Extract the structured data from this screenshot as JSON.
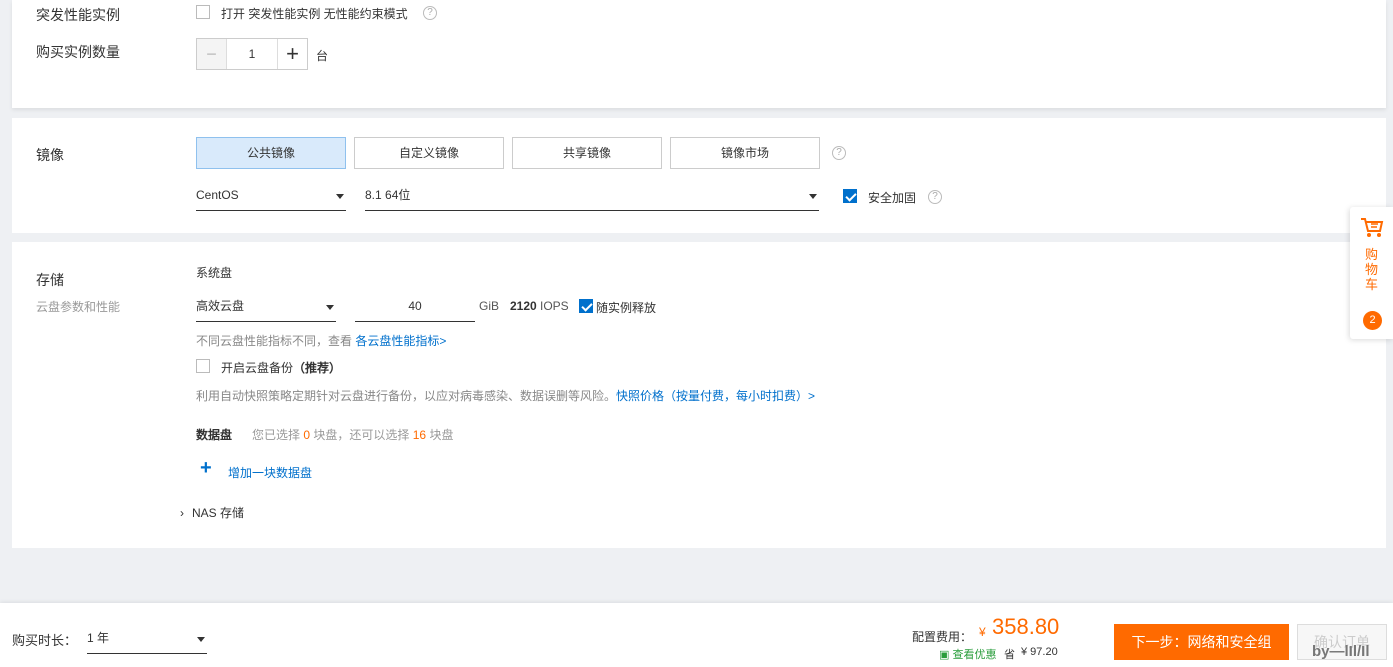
{
  "instance": {
    "burst_label": "突发性能实例",
    "burst_checkbox_label": "打开 突发性能实例 无性能约束模式",
    "quantity_label": "购买实例数量",
    "quantity_value": "1",
    "quantity_unit": "台",
    "minus_symbol": "−",
    "plus_symbol": "+"
  },
  "image": {
    "title": "镜像",
    "tabs": [
      {
        "label": "公共镜像",
        "active": true
      },
      {
        "label": "自定义镜像",
        "active": false
      },
      {
        "label": "共享镜像",
        "active": false
      },
      {
        "label": "镜像市场",
        "active": false
      }
    ],
    "os_value": "CentOS",
    "version_value": "8.1 64位",
    "security_label": "安全加固",
    "security_checked": true
  },
  "storage": {
    "title": "存储",
    "subtitle": "云盘参数和性能",
    "system_disk_label": "系统盘",
    "disk_type_value": "高效云盘",
    "disk_size_value": "40",
    "disk_unit": "GiB",
    "iops_value": "2120",
    "iops_unit": "IOPS",
    "release_label": "随实例释放",
    "release_checked": true,
    "perf_note": "不同云盘性能指标不同，查看",
    "perf_link": "各云盘性能指标>",
    "backup_label": "开启云盘备份",
    "backup_recommend": "（推荐）",
    "backup_note": "利用自动快照策略定期针对云盘进行备份，以应对病毒感染、数据误删等风险。",
    "backup_link": "快照价格（按量付费，每小时扣费）>",
    "data_disk_label": "数据盘",
    "data_disk_text_1": "您已选择",
    "data_disk_selected": "0",
    "data_disk_text_2": "块盘，还可以选择",
    "data_disk_remaining": "16",
    "data_disk_text_3": "块盘",
    "add_data_disk": "增加一块数据盘",
    "nas_label": "NAS 存储"
  },
  "cart": {
    "label": "购物车",
    "count": "2"
  },
  "footer": {
    "duration_label": "购买时长：",
    "duration_value": "1 年",
    "cost_label": "配置费用：",
    "currency": "¥",
    "price": "358.80",
    "discount_link": "查看优惠",
    "save_label": "省",
    "save_amount": "¥ 97.20",
    "next_button": "下一步：网络和安全组",
    "confirm_button": "确认订单",
    "watermark": "by—lIl/Il"
  },
  "colors": {
    "accent": "#ff6a00",
    "link": "#0070cc",
    "tab_active_bg": "#d9eafb"
  }
}
